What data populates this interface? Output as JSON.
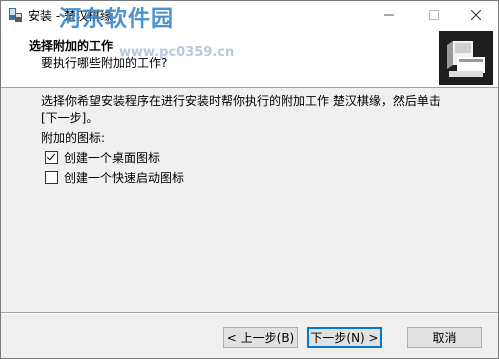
{
  "window": {
    "title": "安装 - 楚汉棋缘",
    "watermark_text": "河东软件园",
    "watermark_url": "www.pc0359.cn"
  },
  "header": {
    "title": "选择附加的工作",
    "subtitle": "要执行哪些附加的工作?"
  },
  "main": {
    "description": "选择你希望安装程序在进行安装时帮你执行的附加工作 楚汉棋缘，然后单击 [下一步]。",
    "group_label": "附加的图标:",
    "options": [
      {
        "label": "创建一个桌面图标",
        "checked": true
      },
      {
        "label": "创建一个快速启动图标",
        "checked": false
      }
    ]
  },
  "footer": {
    "back_label": "< 上一步(B)",
    "next_label": "下一步(N) >",
    "cancel_label": "取消"
  }
}
